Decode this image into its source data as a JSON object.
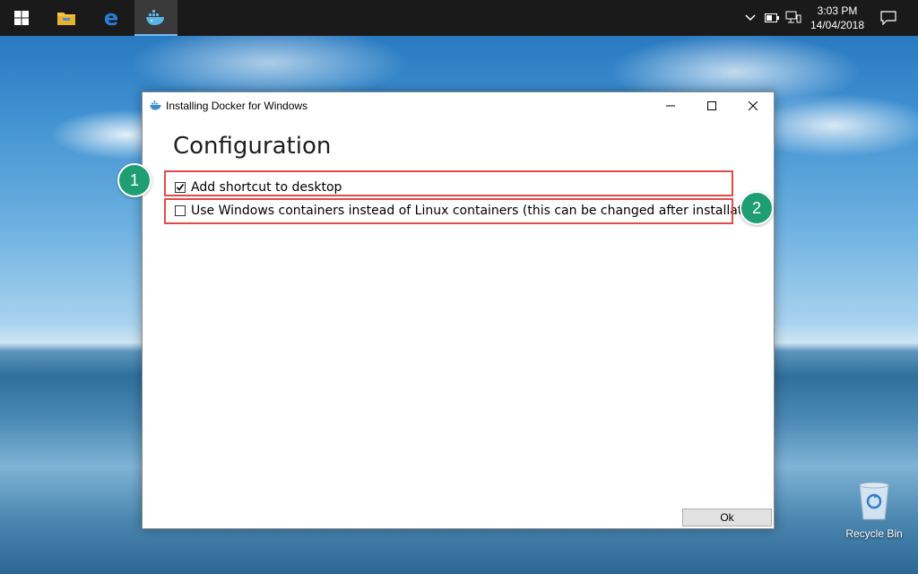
{
  "taskbar": {
    "clock_time": "3:03 PM",
    "clock_date": "14/04/2018",
    "apps": [
      "start-icon",
      "file-explorer-icon",
      "edge-icon",
      "docker-icon"
    ]
  },
  "window": {
    "title": "Installing Docker for Windows",
    "heading": "Configuration",
    "options": [
      {
        "label": "Add shortcut to desktop",
        "checked": true
      },
      {
        "label": "Use Windows containers instead of Linux containers (this can be changed after installation)",
        "checked": false
      }
    ],
    "ok_label": "Ok"
  },
  "callouts": [
    "1",
    "2"
  ],
  "desktop": {
    "recycle_bin_label": "Recycle Bin"
  },
  "colors": {
    "callout_green": "#1f9e74",
    "highlight_red": "#e24a4a",
    "taskbar": "#1a1a1a"
  }
}
